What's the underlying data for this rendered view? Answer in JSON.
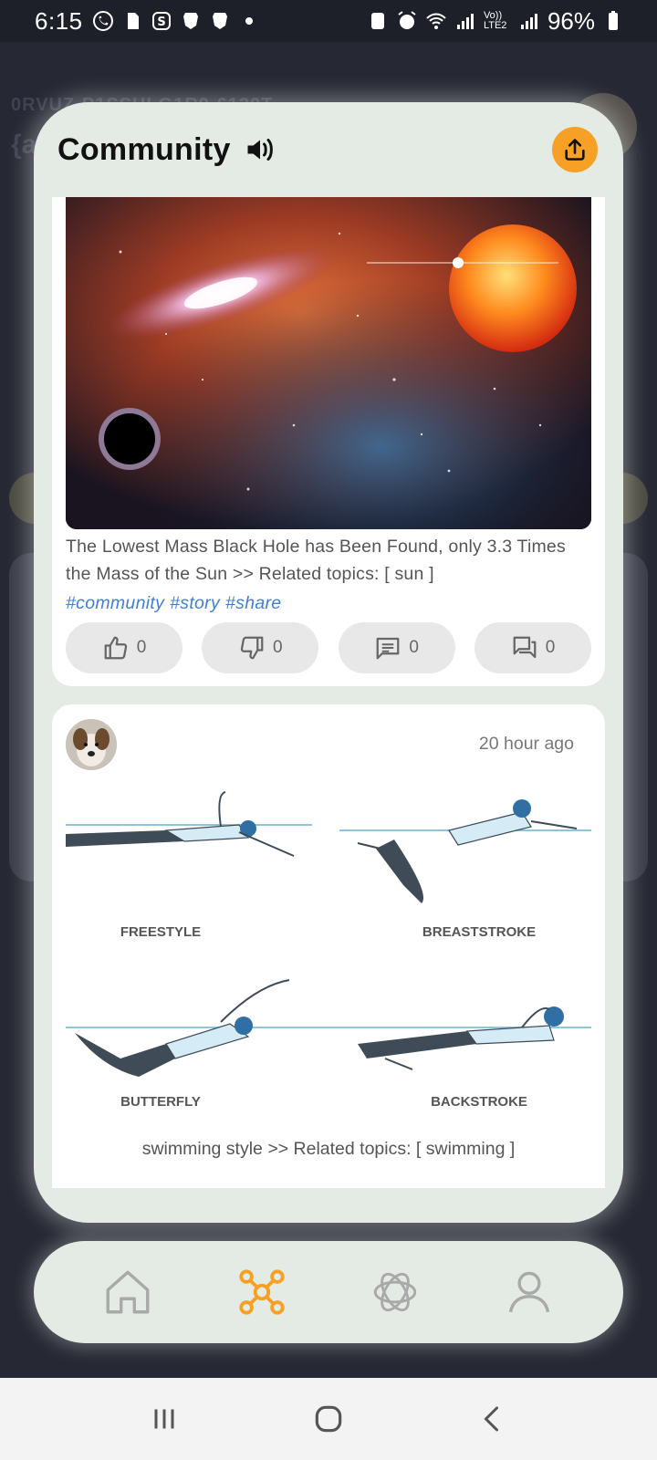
{
  "status_bar": {
    "time": "6:15",
    "battery": "96%",
    "network_label": "Vo)) LTE2"
  },
  "background_app": {
    "id_text": "0RVUZ-P1SSHLG1R9-6120T",
    "handle_text": "{a"
  },
  "community": {
    "title": "Community",
    "icons": {
      "speaker": "speaker-icon",
      "share": "share-icon"
    },
    "accent_color": "#f6a126",
    "posts": [
      {
        "image_alt": "space-galaxy-black-hole-image",
        "caption": "The Lowest Mass Black Hole has Been Found, only 3.3 Times the Mass of the Sun >> Related topics: [ sun ]",
        "tags": [
          "#community",
          "#story",
          "#share"
        ],
        "actions": {
          "likes": "0",
          "dislikes": "0",
          "comments": "0",
          "replies": "0"
        }
      },
      {
        "time": "20 hour ago",
        "image_labels": {
          "freestyle": "FREESTYLE",
          "breaststroke": "BREASTSTROKE",
          "butterfly": "BUTTERFLY",
          "backstroke": "BACKSTROKE"
        },
        "caption": "swimming style >> Related topics: [ swimming ]"
      }
    ]
  },
  "bottom_nav": {
    "items": [
      {
        "name": "home",
        "icon": "home-icon",
        "active": false
      },
      {
        "name": "community",
        "icon": "network-icon",
        "active": true
      },
      {
        "name": "ai",
        "icon": "ai-icon",
        "active": false
      },
      {
        "name": "profile",
        "icon": "person-icon",
        "active": false
      }
    ],
    "active_color": "#f6a126",
    "inactive_color": "#a9a9a9"
  }
}
